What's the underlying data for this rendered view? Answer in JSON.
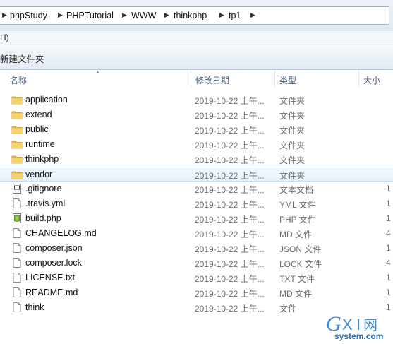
{
  "breadcrumb": [
    "phpStudy",
    "PHPTutorial",
    "WWW",
    "thinkphp",
    "tp1"
  ],
  "menu": {
    "help_fragment": "H)"
  },
  "toolbar": {
    "new_folder": "新建文件夹"
  },
  "columns": {
    "name": "名称",
    "date": "修改日期",
    "type": "类型",
    "size": "大小"
  },
  "files": [
    {
      "name": "application",
      "date": "2019-10-22 上午...",
      "type": "文件夹",
      "size": "",
      "icon": "folder-icon"
    },
    {
      "name": "extend",
      "date": "2019-10-22 上午...",
      "type": "文件夹",
      "size": "",
      "icon": "folder-icon"
    },
    {
      "name": "public",
      "date": "2019-10-22 上午...",
      "type": "文件夹",
      "size": "",
      "icon": "folder-icon"
    },
    {
      "name": "runtime",
      "date": "2019-10-22 上午...",
      "type": "文件夹",
      "size": "",
      "icon": "folder-icon"
    },
    {
      "name": "thinkphp",
      "date": "2019-10-22 上午...",
      "type": "文件夹",
      "size": "",
      "icon": "folder-icon"
    },
    {
      "name": "vendor",
      "date": "2019-10-22 上午...",
      "type": "文件夹",
      "size": "",
      "icon": "folder-icon",
      "selected": true
    },
    {
      "name": ".gitignore",
      "date": "2019-10-22 上午...",
      "type": "文本文档",
      "size": "1",
      "icon": "text-file-icon"
    },
    {
      "name": ".travis.yml",
      "date": "2019-10-22 上午...",
      "type": "YML 文件",
      "size": "1",
      "icon": "file-icon"
    },
    {
      "name": "build.php",
      "date": "2019-10-22 上午...",
      "type": "PHP 文件",
      "size": "1",
      "icon": "php-file-icon"
    },
    {
      "name": "CHANGELOG.md",
      "date": "2019-10-22 上午...",
      "type": "MD 文件",
      "size": "4",
      "icon": "file-icon"
    },
    {
      "name": "composer.json",
      "date": "2019-10-22 上午...",
      "type": "JSON 文件",
      "size": "1",
      "icon": "file-icon"
    },
    {
      "name": "composer.lock",
      "date": "2019-10-22 上午...",
      "type": "LOCK 文件",
      "size": "4",
      "icon": "file-icon"
    },
    {
      "name": "LICENSE.txt",
      "date": "2019-10-22 上午...",
      "type": "TXT 文件",
      "size": "1",
      "icon": "file-icon"
    },
    {
      "name": "README.md",
      "date": "2019-10-22 上午...",
      "type": "MD 文件",
      "size": "1",
      "icon": "file-icon"
    },
    {
      "name": "think",
      "date": "2019-10-22 上午...",
      "type": "文件",
      "size": "1",
      "icon": "file-icon"
    }
  ],
  "watermark": {
    "logo": "GXI网",
    "domain": "system.com"
  }
}
